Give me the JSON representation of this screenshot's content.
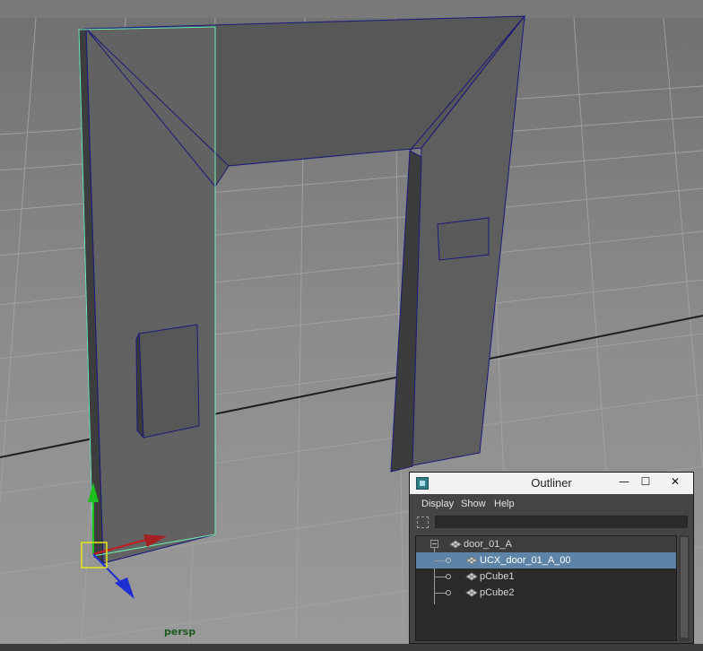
{
  "viewport": {
    "camera_label": "persp"
  },
  "outliner": {
    "title": "Outliner",
    "window_controls": {
      "minimize": "—",
      "maximize": "☐",
      "close": "✕"
    },
    "menu": [
      "Display",
      "Show",
      "Help"
    ],
    "search": {
      "value": ""
    },
    "tree": {
      "root": {
        "label": "door_01_A",
        "expanded": true
      },
      "children": [
        {
          "label": "UCX_door_01_A_00",
          "selected": true
        },
        {
          "label": "pCube1",
          "selected": false
        },
        {
          "label": "pCube2",
          "selected": false
        }
      ]
    }
  },
  "colors": {
    "viewport_bg": "#8a8a8a",
    "selection_highlight": "#5d84a7",
    "wireframe_active": "#6ff0b0",
    "wireframe_edges": "#1a1a7a"
  }
}
